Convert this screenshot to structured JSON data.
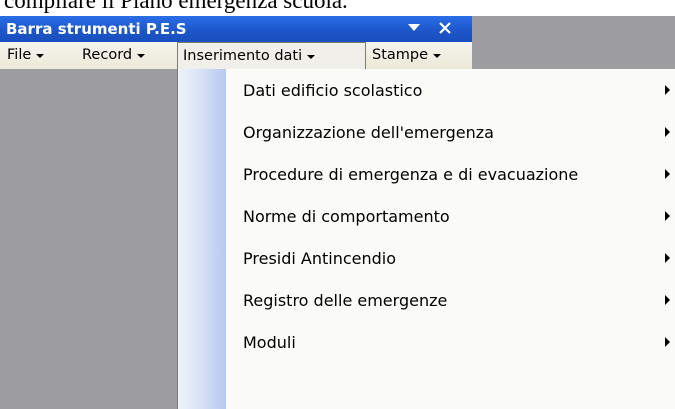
{
  "top_text": "compilare il Piano emergenza scuola.",
  "window": {
    "title": "Barra strumenti P.E.S"
  },
  "menubar": {
    "items": [
      {
        "label": "File"
      },
      {
        "label": "Record"
      },
      {
        "label": "Inserimento dati"
      },
      {
        "label": "Stampe"
      }
    ]
  },
  "dropdown": {
    "items": [
      {
        "label": "Dati edificio scolastico"
      },
      {
        "label": "Organizzazione dell'emergenza"
      },
      {
        "label": "Procedure di emergenza e di evacuazione"
      },
      {
        "label": "Norme di comportamento"
      },
      {
        "label": "Presidi Antincendio"
      },
      {
        "label": "Registro delle emergenze"
      },
      {
        "label": "Moduli"
      }
    ]
  },
  "colors": {
    "titlebar": "#1c55c8",
    "menubar": "#ece9d8",
    "background": "#9d9da1",
    "menu_gutter": "#b7c9ee"
  }
}
